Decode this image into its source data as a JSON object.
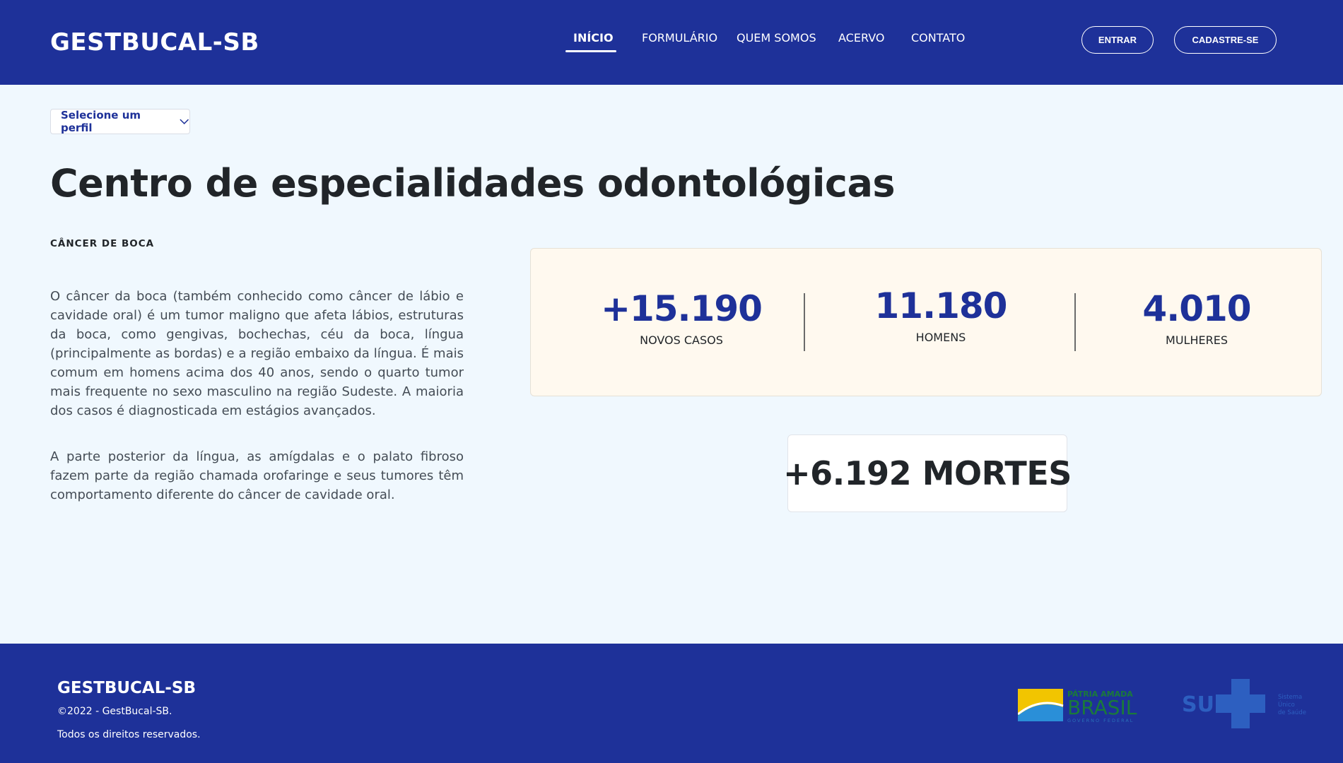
{
  "header": {
    "brand": "GESTBUCAL-SB",
    "nav": [
      {
        "label": "INÍCIO",
        "active": true
      },
      {
        "label": "FORMULÁRIO",
        "active": false
      },
      {
        "label": "QUEM SOMOS",
        "active": false
      },
      {
        "label": "ACERVO",
        "active": false
      },
      {
        "label": "CONTATO",
        "active": false
      }
    ],
    "login_label": "ENTRAR",
    "signup_label": "CADASTRE-SE"
  },
  "profile_select": {
    "label": "Selecione um perfil",
    "icon": "chevron-down-icon"
  },
  "main": {
    "title": "Centro de especialidades odontológicas",
    "section_label": "CÂNCER DE BOCA",
    "paragraphs": [
      "O câncer da boca (também conhecido como câncer de lábio e cavidade oral) é um tumor maligno que afeta lábios, estruturas da boca, como gengivas, bochechas, céu da boca, língua (principalmente as bordas) e a região embaixo da língua. É mais comum em homens acima dos 40 anos, sendo o quarto tumor mais frequente no sexo masculino na região Sudeste. A maioria dos casos é diagnosticada em estágios avançados.",
      "A parte posterior da língua, as amígdalas e o palato fibroso fazem parte da região chamada orofaringe e seus tumores têm comportamento diferente do câncer de cavidade oral."
    ],
    "stats": [
      {
        "value": "+15.190",
        "label": "NOVOS CASOS"
      },
      {
        "value": "11.180",
        "label": "HOMENS"
      },
      {
        "value": "4.010",
        "label": "MULHERES"
      }
    ],
    "deaths": "+6.192 MORTES"
  },
  "footer": {
    "brand": "GESTBUCAL-SB",
    "copyright": "©2022 - GestBucal-SB.",
    "rights": "Todos os direitos reservados.",
    "logo_brasil": {
      "line1": "PÁTRIA AMADA",
      "line2": "BRASIL",
      "line3": "GOVERNO FEDERAL"
    },
    "logo_sus": {
      "mark": "SUS",
      "line1": "Sistema",
      "line2": "Único",
      "line3": "de Saúde"
    }
  },
  "colors": {
    "primary": "#1e3199",
    "background": "#f0f8fe",
    "stats_card": "#fff9ef"
  }
}
